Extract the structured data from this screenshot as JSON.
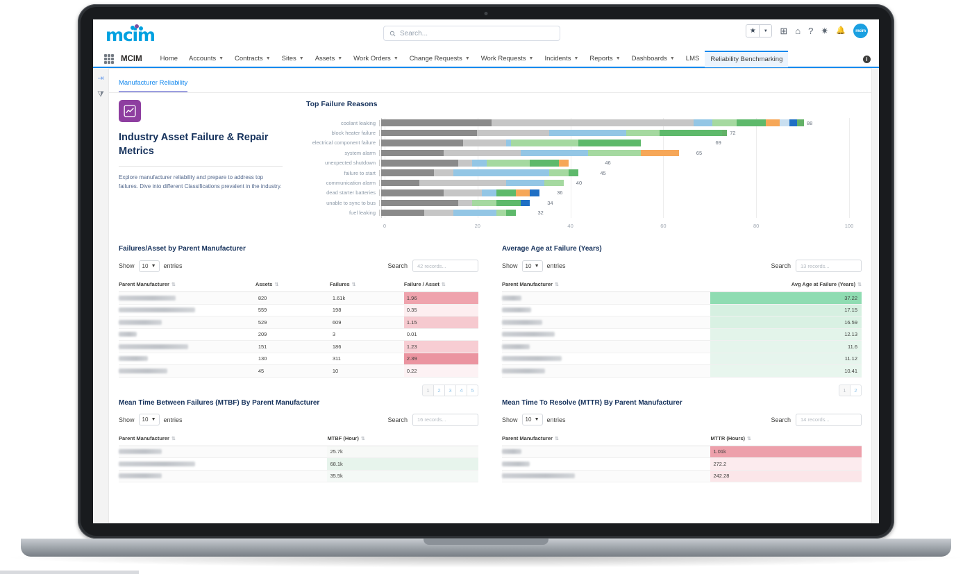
{
  "app": {
    "logo_text": "mcim",
    "app_name": "MCIM",
    "avatar_text": "mcim"
  },
  "search": {
    "placeholder": "Search...",
    "icon": "search-icon"
  },
  "header_icons": [
    {
      "name": "favorites-star-icon",
      "glyph": "★"
    },
    {
      "name": "favorites-dropdown-icon",
      "glyph": "▾"
    },
    {
      "name": "add-icon",
      "glyph": "⊞"
    },
    {
      "name": "cloud-icon",
      "glyph": "☁"
    },
    {
      "name": "help-icon",
      "glyph": "?"
    },
    {
      "name": "gear-icon",
      "glyph": "✿"
    },
    {
      "name": "bell-icon",
      "glyph": "🔔"
    }
  ],
  "nav": {
    "items": [
      {
        "label": "Home",
        "caret": false
      },
      {
        "label": "Accounts",
        "caret": true
      },
      {
        "label": "Contracts",
        "caret": true
      },
      {
        "label": "Sites",
        "caret": true
      },
      {
        "label": "Assets",
        "caret": true
      },
      {
        "label": "Work Orders",
        "caret": true
      },
      {
        "label": "Change Requests",
        "caret": true
      },
      {
        "label": "Work Requests",
        "caret": true
      },
      {
        "label": "Incidents",
        "caret": true
      },
      {
        "label": "Reports",
        "caret": true
      },
      {
        "label": "Dashboards",
        "caret": true
      },
      {
        "label": "LMS",
        "caret": false
      },
      {
        "label": "Reliability Benchmarking",
        "caret": false,
        "active": true
      }
    ],
    "info_glyph": "i"
  },
  "rail": {
    "collapse_icon": "⇥",
    "filter_icon": "⧩"
  },
  "tabs": {
    "manufacturer_reliability": "Manufacturer Reliability"
  },
  "intro": {
    "title": "Industry Asset Failure & Repair Metrics",
    "body": "Explore manufacturer reliability and prepare to address top failures. Dive into different Classifications prevalent in the industry.",
    "icon": "line-chart-icon"
  },
  "chart_data": {
    "type": "bar",
    "orientation": "horizontal",
    "stacked": true,
    "title": "Top Failure Reasons",
    "xlabel": "",
    "ylabel": "",
    "xlim": [
      0,
      100
    ],
    "xticks": [
      0,
      20,
      40,
      60,
      80,
      100
    ],
    "grid": true,
    "legend": "none",
    "categories": [
      "coolant leaking",
      "block heater failure",
      "electrical component failure",
      "system alarm",
      "unexpected shutdown",
      "failure to start",
      "communication alarm",
      "dead starter batteries",
      "unable to sync to bus",
      "fuel leaking"
    ],
    "totals": [
      88,
      72,
      69,
      65,
      46,
      45,
      40,
      36,
      34,
      32
    ],
    "segment_colors": [
      "#8a8a8a",
      "#c6c6c6",
      "#93c6e5",
      "#a5d9a0",
      "#5eb96b",
      "#f6a758",
      "#c9dff0",
      "#1f6fc4",
      "#63b167"
    ],
    "stacks": [
      {
        "category": "coolant leaking",
        "segments": [
          23,
          42,
          4,
          5,
          6,
          3,
          2,
          1.5,
          1.5
        ]
      },
      {
        "category": "block heater failure",
        "segments": [
          20,
          15,
          16,
          7,
          13,
          0,
          0,
          0,
          1
        ]
      },
      {
        "category": "electrical component failure",
        "segments": [
          17,
          9,
          1,
          14,
          13,
          0,
          0,
          0,
          0
        ]
      },
      {
        "category": "system alarm",
        "segments": [
          13,
          16,
          14,
          11,
          0,
          8,
          0,
          0,
          0
        ]
      },
      {
        "category": "unexpected shutdown",
        "segments": [
          16,
          3,
          3,
          9,
          6,
          2,
          0,
          0,
          0
        ]
      },
      {
        "category": "failure to start",
        "segments": [
          11,
          4,
          20,
          4,
          2,
          0,
          0,
          0,
          0
        ]
      },
      {
        "category": "communication alarm",
        "segments": [
          8,
          18,
          8,
          4,
          0,
          0,
          0,
          0,
          0
        ]
      },
      {
        "category": "dead starter batteries",
        "segments": [
          13,
          8,
          3,
          0,
          4,
          3,
          0,
          2,
          0
        ]
      },
      {
        "category": "unable to sync to bus",
        "segments": [
          16,
          3,
          0,
          5,
          5,
          0,
          0,
          2,
          0
        ]
      },
      {
        "category": "fuel leaking",
        "segments": [
          9,
          6,
          9,
          2,
          2,
          0,
          0,
          0,
          0
        ]
      }
    ]
  },
  "tables": [
    {
      "id": "failures-per-asset",
      "title": "Failures/Asset by Parent Manufacturer",
      "show_label": "Show",
      "entries_label": "entries",
      "page_size": "10",
      "search_label": "Search",
      "search_placeholder": "42 records...",
      "columns": [
        "Parent Manufacturer",
        "Assets",
        "Failures",
        "Failure / Asset"
      ],
      "col_align": [
        "left",
        "left",
        "left",
        "left"
      ],
      "rows": [
        {
          "mfr_width": 82,
          "cells": [
            "820",
            "1.61k",
            "1.96"
          ],
          "heat": "#efa3ad"
        },
        {
          "mfr_width": 110,
          "cells": [
            "559",
            "198",
            "0.35"
          ],
          "heat": "#fdeef0"
        },
        {
          "mfr_width": 62,
          "cells": [
            "529",
            "609",
            "1.15"
          ],
          "heat": "#f6c9cf"
        },
        {
          "mfr_width": 26,
          "cells": [
            "209",
            "3",
            "0.01"
          ],
          "heat": "#ffffff"
        },
        {
          "mfr_width": 100,
          "cells": [
            "151",
            "186",
            "1.23"
          ],
          "heat": "#f7cdd3"
        },
        {
          "mfr_width": 42,
          "cells": [
            "130",
            "311",
            "2.39"
          ],
          "heat": "#eb94a0"
        },
        {
          "mfr_width": 70,
          "cells": [
            "45",
            "10",
            "0.22"
          ],
          "heat": "#fdf2f4"
        }
      ],
      "pages": [
        "1",
        "2",
        "3",
        "4",
        "5"
      ],
      "active_page": "1"
    },
    {
      "id": "avg-age-at-failure",
      "title": "Average Age at Failure (Years)",
      "show_label": "Show",
      "entries_label": "entries",
      "page_size": "10",
      "search_label": "Search",
      "search_placeholder": "13 records...",
      "columns": [
        "Parent Manufacturer",
        "Avg Age at Failure (Years)"
      ],
      "col_align": [
        "left",
        "right"
      ],
      "rows": [
        {
          "mfr_width": 28,
          "cells": [
            "37.22"
          ],
          "heat": "#8fdcb2"
        },
        {
          "mfr_width": 42,
          "cells": [
            "17.15"
          ],
          "heat": "#d6f0e1"
        },
        {
          "mfr_width": 58,
          "cells": [
            "16.59"
          ],
          "heat": "#d9f1e3"
        },
        {
          "mfr_width": 76,
          "cells": [
            "12.13"
          ],
          "heat": "#e3f4ea"
        },
        {
          "mfr_width": 40,
          "cells": [
            "11.6"
          ],
          "heat": "#e5f5ec"
        },
        {
          "mfr_width": 86,
          "cells": [
            "11.12"
          ],
          "heat": "#e6f5ed"
        },
        {
          "mfr_width": 62,
          "cells": [
            "10.41"
          ],
          "heat": "#e8f6ee"
        }
      ],
      "pages": [
        "1",
        "2"
      ],
      "active_page": "1"
    },
    {
      "id": "mtbf",
      "title": "Mean Time Between Failures (MTBF) By Parent Manufacturer",
      "show_label": "Show",
      "entries_label": "entries",
      "page_size": "10",
      "search_label": "Search",
      "search_placeholder": "16 records...",
      "columns": [
        "Parent Manufacturer",
        "MTBF (Hour)"
      ],
      "col_align": [
        "left",
        "left"
      ],
      "rows": [
        {
          "mfr_width": 62,
          "cells": [
            "25.7k"
          ],
          "heat": "#f7f9f7"
        },
        {
          "mfr_width": 110,
          "cells": [
            "68.1k"
          ],
          "heat": "#e7f4ec"
        },
        {
          "mfr_width": 62,
          "cells": [
            "35.5k"
          ],
          "heat": "#f4f9f6"
        }
      ],
      "pages": [],
      "active_page": "1"
    },
    {
      "id": "mttr",
      "title": "Mean Time To Resolve (MTTR) By Parent Manufacturer",
      "show_label": "Show",
      "entries_label": "entries",
      "page_size": "10",
      "search_label": "Search",
      "search_placeholder": "14 records...",
      "columns": [
        "Parent Manufacturer",
        "MTTR (Hours)"
      ],
      "col_align": [
        "left",
        "left"
      ],
      "rows": [
        {
          "mfr_width": 28,
          "cells": [
            "1.01k"
          ],
          "heat": "#eda0ab"
        },
        {
          "mfr_width": 40,
          "cells": [
            "272.2"
          ],
          "heat": "#fcebee"
        },
        {
          "mfr_width": 105,
          "cells": [
            "242.28"
          ],
          "heat": "#fbe6e9"
        }
      ],
      "pages": [],
      "active_page": "1"
    }
  ]
}
